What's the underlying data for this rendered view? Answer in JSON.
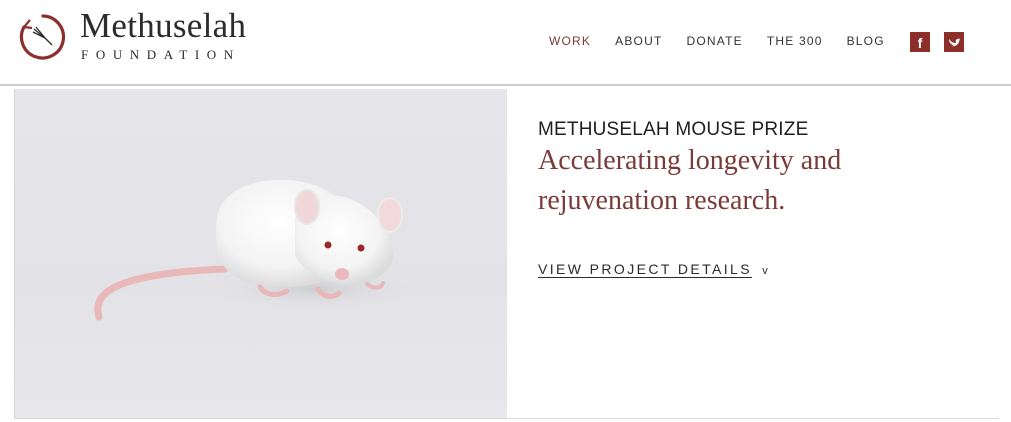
{
  "brand": {
    "title": "Methuselah",
    "subtitle": "FOUNDATION",
    "accent": "#8c2f2b",
    "logo_icon": "hourglass-circle-icon"
  },
  "nav": {
    "items": [
      {
        "label": "WORK",
        "active": true
      },
      {
        "label": "ABOUT",
        "active": false
      },
      {
        "label": "DONATE",
        "active": false
      },
      {
        "label": "THE 300",
        "active": false
      },
      {
        "label": "BLOG",
        "active": false
      }
    ],
    "social": [
      {
        "icon": "facebook-icon",
        "glyph": "f"
      },
      {
        "icon": "twitter-icon",
        "glyph": "🐦"
      }
    ]
  },
  "hero": {
    "image_icon": "white-mouse-image",
    "eyebrow": "METHUSELAH MOUSE PRIZE",
    "headline": "Accelerating longevity and rejuvenation research.",
    "link_label": "VIEW PROJECT DETAILS",
    "link_chevron": "v"
  }
}
